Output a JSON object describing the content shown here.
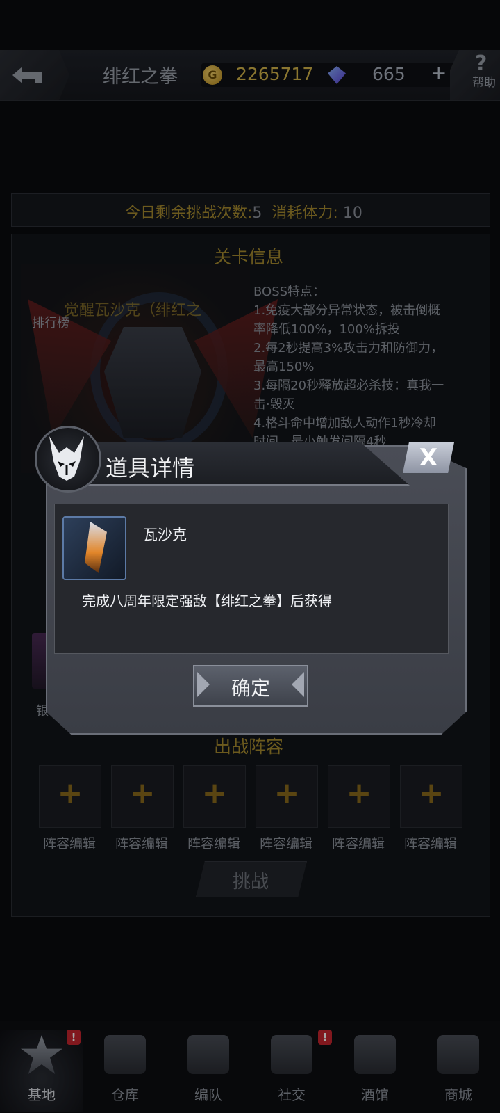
{
  "header": {
    "title": "绯红之拳",
    "gold": "2265717",
    "gems": "665",
    "plus": "+",
    "help_icon": "?",
    "help_label": "帮助"
  },
  "challenge_info": {
    "remaining_label": "今日剩余挑战次数:",
    "remaining_value": "5",
    "stamina_label": "消耗体力:",
    "stamina_value": "10"
  },
  "level": {
    "title": "关卡信息",
    "rank_label": "排行榜",
    "boss_name": "觉醒瓦沙克（绯红之",
    "traits": [
      "BOSS特点：",
      "1.免疫大部分异常状态，被击倒概",
      "率降低100%，100%拆投",
      "2.每2秒提高3%攻击力和防御力，",
      "最高150%",
      "3.每隔20秒释放超必杀技：真我一",
      "击·毁灭",
      "4.格斗命中增加敌人动作1秒冷却",
      "时间，最小触发间隔4秒"
    ],
    "side_label": "银"
  },
  "lineup": {
    "title": "出战阵容",
    "slot_symbol": "+",
    "slots": [
      "阵容编辑",
      "阵容编辑",
      "阵容编辑",
      "阵容编辑",
      "阵容编辑",
      "阵容编辑"
    ],
    "challenge_button": "挑战"
  },
  "nav": [
    {
      "label": "基地",
      "icon": "base-icon",
      "alert": "!"
    },
    {
      "label": "仓库",
      "icon": "warehouse-icon"
    },
    {
      "label": "编队",
      "icon": "helmet-icon"
    },
    {
      "label": "社交",
      "icon": "handshake-icon",
      "alert": "!"
    },
    {
      "label": "酒馆",
      "icon": "tavern-icon"
    },
    {
      "label": "商城",
      "icon": "shop-icon"
    }
  ],
  "modal": {
    "title": "道具详情",
    "close_label": "X",
    "item_name": "瓦沙克",
    "item_description": "完成八周年限定强敌【绯红之拳】后获得",
    "confirm_label": "确定"
  }
}
